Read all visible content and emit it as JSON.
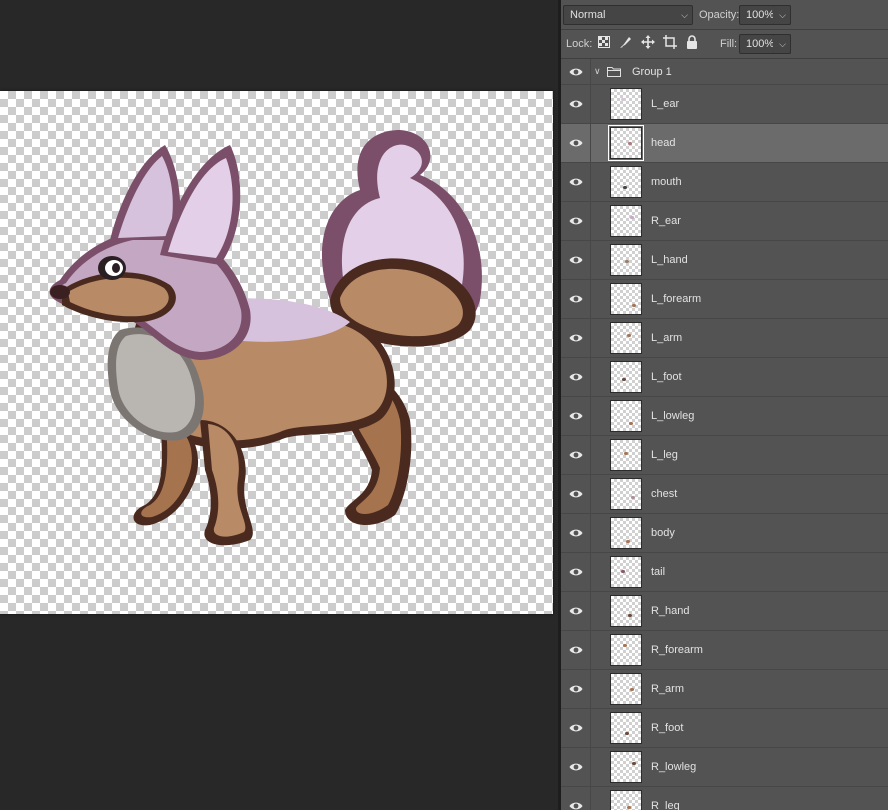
{
  "blend": {
    "mode": "Normal",
    "opacity_label": "Opacity:",
    "opacity_value": "100%"
  },
  "lock": {
    "label": "Lock:",
    "fill_label": "Fill:",
    "fill_value": "100%",
    "icons": [
      "lock-transparent-pixels-icon",
      "lock-image-pixels-icon",
      "lock-position-icon",
      "lock-artboard-icon",
      "lock-all-icon"
    ]
  },
  "group": {
    "name": "Group 1",
    "expanded": true
  },
  "layers": [
    {
      "name": "L_ear",
      "selected": false,
      "thumb_color": "#d9c6da"
    },
    {
      "name": "head",
      "selected": true,
      "thumb_color": "#b07a7a"
    },
    {
      "name": "mouth",
      "selected": false,
      "thumb_color": "#444444"
    },
    {
      "name": "R_ear",
      "selected": false,
      "thumb_color": "#c9a9c9"
    },
    {
      "name": "L_hand",
      "selected": false,
      "thumb_color": "#9b7d6a"
    },
    {
      "name": "L_forearm",
      "selected": false,
      "thumb_color": "#a67654"
    },
    {
      "name": "L_arm",
      "selected": false,
      "thumb_color": "#a67654"
    },
    {
      "name": "L_foot",
      "selected": false,
      "thumb_color": "#6b4a3a"
    },
    {
      "name": "L_lowleg",
      "selected": false,
      "thumb_color": "#a67654"
    },
    {
      "name": "L_leg",
      "selected": false,
      "thumb_color": "#a67654"
    },
    {
      "name": "chest",
      "selected": false,
      "thumb_color": "#b08f9d"
    },
    {
      "name": "body",
      "selected": false,
      "thumb_color": "#b07358"
    },
    {
      "name": "tail",
      "selected": false,
      "thumb_color": "#8a5a6a"
    },
    {
      "name": "R_hand",
      "selected": false,
      "thumb_color": "#6b4a3a"
    },
    {
      "name": "R_forearm",
      "selected": false,
      "thumb_color": "#a67654"
    },
    {
      "name": "R_arm",
      "selected": false,
      "thumb_color": "#a67654"
    },
    {
      "name": "R_foot",
      "selected": false,
      "thumb_color": "#6b4a3a"
    },
    {
      "name": "R_lowleg",
      "selected": false,
      "thumb_color": "#6b4a3a"
    },
    {
      "name": "R_leg",
      "selected": false,
      "thumb_color": "#a67654"
    }
  ],
  "colors": {
    "panel": "#535353",
    "selected_row": "#6b6b6b",
    "outline": "#4a2a1f",
    "fur_tan": "#b88a66",
    "fur_lilac": "#d6c2dc",
    "fur_gray": "#aaa8a6"
  }
}
